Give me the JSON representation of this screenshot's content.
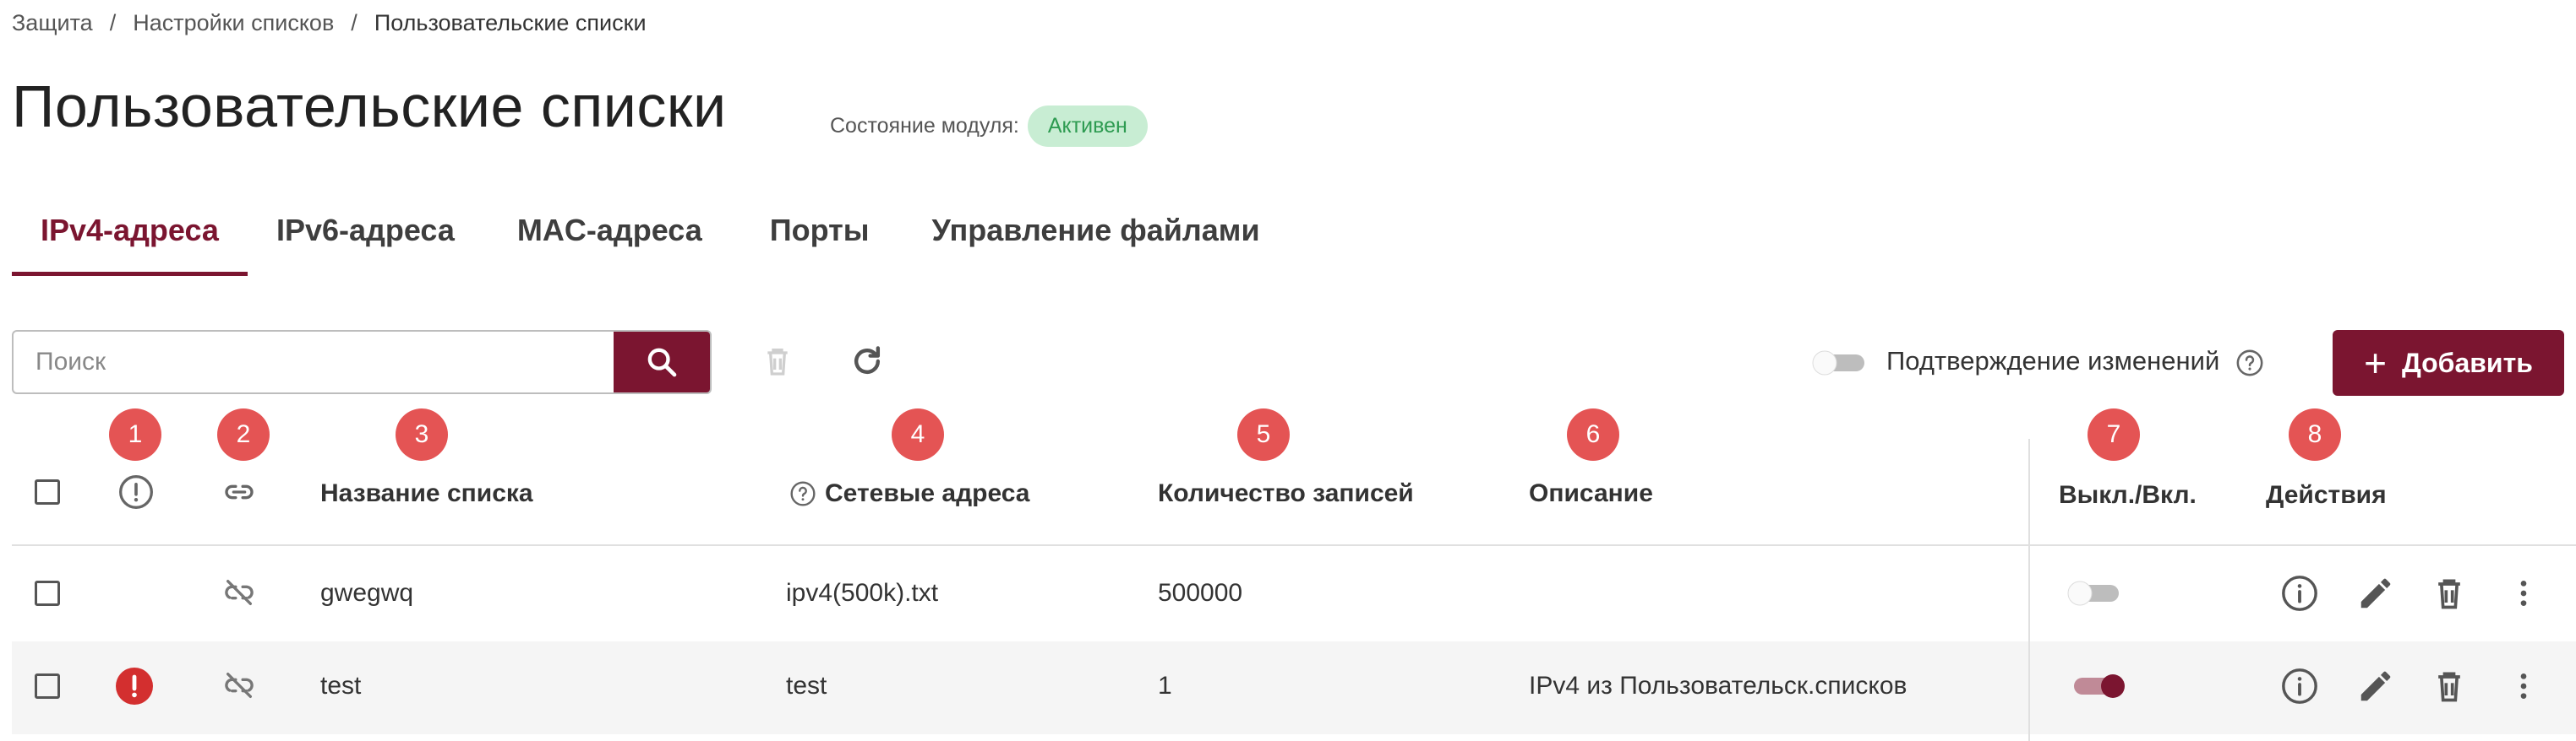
{
  "breadcrumb": {
    "items": [
      "Защита",
      "Настройки списков",
      "Пользовательские списки"
    ],
    "separator": "/"
  },
  "page": {
    "title": "Пользовательские списки",
    "module_state_label": "Состояние модуля:",
    "module_state_value": "Активен"
  },
  "tabs": [
    {
      "label": "IPv4-адреса",
      "active": true
    },
    {
      "label": "IPv6-адреса",
      "active": false
    },
    {
      "label": "MAC-адреса",
      "active": false
    },
    {
      "label": "Порты",
      "active": false
    },
    {
      "label": "Управление файлами",
      "active": false
    }
  ],
  "toolbar": {
    "search_placeholder": "Поиск",
    "confirm_changes_label": "Подтверждение изменений",
    "confirm_changes_enabled": false,
    "add_label": "Добавить"
  },
  "markers": [
    "1",
    "2",
    "3",
    "4",
    "5",
    "6",
    "7",
    "8"
  ],
  "table": {
    "columns": {
      "name": "Название списка",
      "addresses": "Сетевые адреса",
      "count": "Количество записей",
      "description": "Описание",
      "toggle": "Выкл./Вкл.",
      "actions": "Действия"
    },
    "rows": [
      {
        "error": false,
        "name": "gwegwq",
        "addresses": "ipv4(500k).txt",
        "count": "500000",
        "description": "",
        "enabled": false
      },
      {
        "error": true,
        "name": "test",
        "addresses": "test",
        "count": "1",
        "description": "IPv4 из Пользовательск.списков",
        "enabled": true
      }
    ]
  },
  "colors": {
    "accent": "#7b1530",
    "marker": "#e45454",
    "active_badge_bg": "#c8edd3",
    "active_badge_text": "#2e9b51",
    "error": "#d32f2f"
  }
}
